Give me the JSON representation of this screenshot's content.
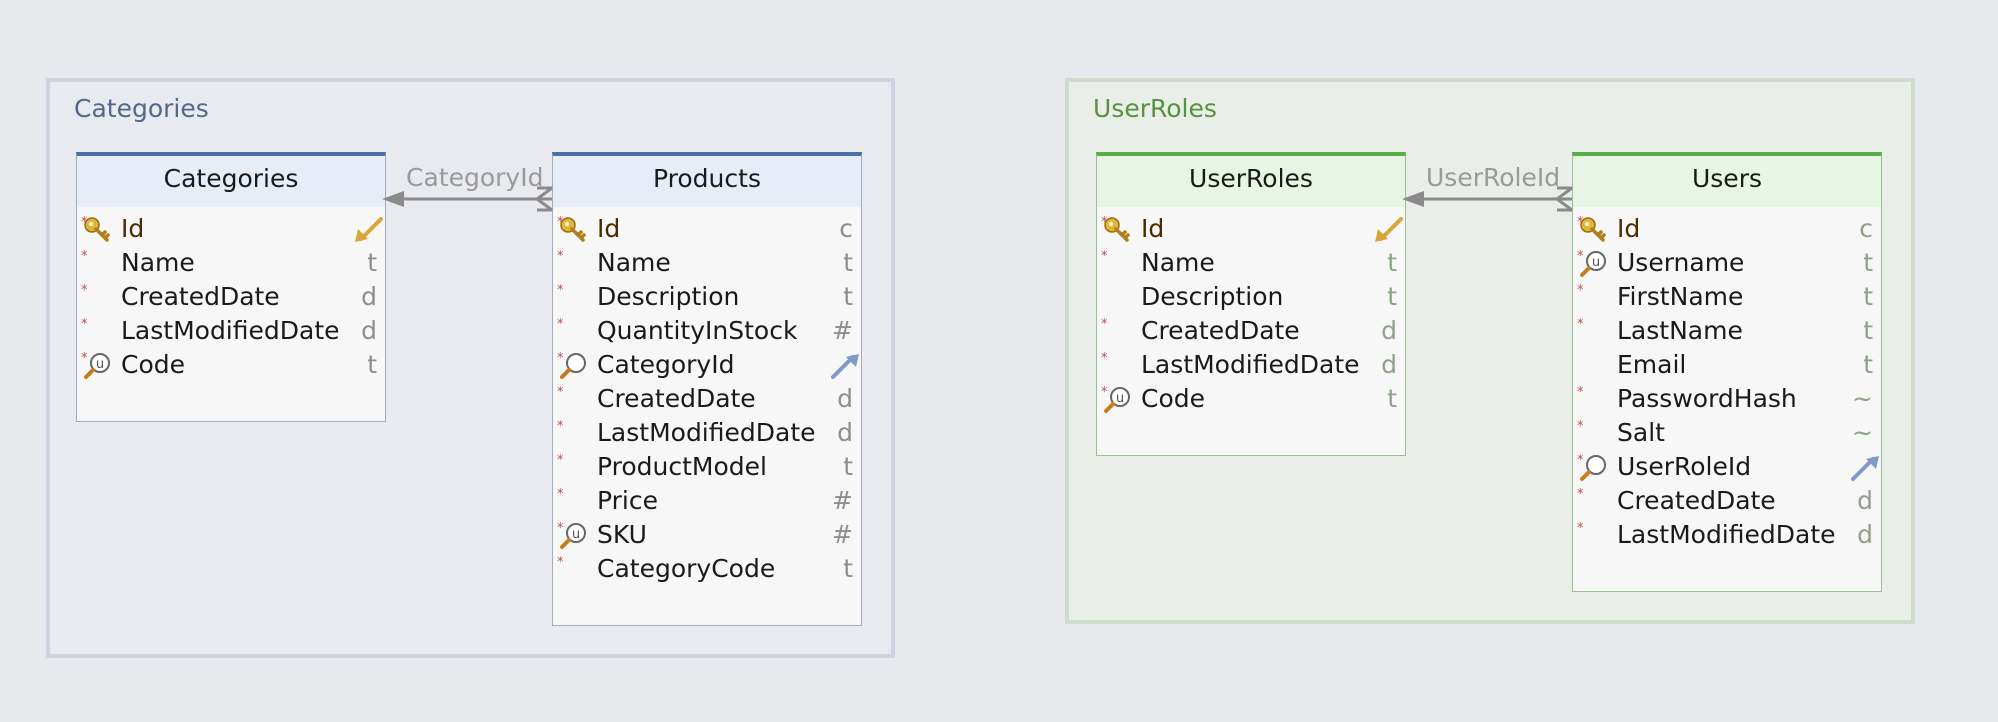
{
  "groups": [
    {
      "title": "Categories",
      "tables": [
        {
          "title": "Categories",
          "columns": [
            {
              "name": "Id",
              "type": "",
              "required": true,
              "icon": "key-icon",
              "type_icon": "key-ref-arrow-icon",
              "pk": true
            },
            {
              "name": "Name",
              "type": "t",
              "required": true,
              "icon": "",
              "pk": false
            },
            {
              "name": "CreatedDate",
              "type": "d",
              "required": true,
              "icon": "",
              "pk": false
            },
            {
              "name": "LastModifiedDate",
              "type": "d",
              "required": true,
              "icon": "",
              "pk": false
            },
            {
              "name": "Code",
              "type": "t",
              "required": true,
              "icon": "unique-index-icon",
              "pk": false
            }
          ]
        },
        {
          "title": "Products",
          "columns": [
            {
              "name": "Id",
              "type": "c",
              "required": true,
              "icon": "key-icon",
              "pk": true
            },
            {
              "name": "Name",
              "type": "t",
              "required": true,
              "icon": "",
              "pk": false
            },
            {
              "name": "Description",
              "type": "t",
              "required": true,
              "icon": "",
              "pk": false
            },
            {
              "name": "QuantityInStock",
              "type": "#",
              "required": true,
              "icon": "",
              "pk": false
            },
            {
              "name": "CategoryId",
              "type": "",
              "required": true,
              "icon": "index-icon",
              "type_icon": "foreign-key-arrow-icon",
              "pk": false
            },
            {
              "name": "CreatedDate",
              "type": "d",
              "required": true,
              "icon": "",
              "pk": false
            },
            {
              "name": "LastModifiedDate",
              "type": "d",
              "required": true,
              "icon": "",
              "pk": false
            },
            {
              "name": "ProductModel",
              "type": "t",
              "required": true,
              "icon": "",
              "pk": false
            },
            {
              "name": "Price",
              "type": "#",
              "required": true,
              "icon": "",
              "pk": false
            },
            {
              "name": "SKU",
              "type": "#",
              "required": true,
              "icon": "unique-index-icon",
              "pk": false
            },
            {
              "name": "CategoryCode",
              "type": "t",
              "required": true,
              "icon": "",
              "pk": false
            }
          ]
        }
      ],
      "relationship": {
        "label": "CategoryId"
      }
    },
    {
      "title": "UserRoles",
      "tables": [
        {
          "title": "UserRoles",
          "columns": [
            {
              "name": "Id",
              "type": "",
              "required": true,
              "icon": "key-icon",
              "type_icon": "key-ref-arrow-icon",
              "pk": true
            },
            {
              "name": "Name",
              "type": "t",
              "required": true,
              "icon": "",
              "pk": false
            },
            {
              "name": "Description",
              "type": "t",
              "required": false,
              "icon": "",
              "pk": false
            },
            {
              "name": "CreatedDate",
              "type": "d",
              "required": true,
              "icon": "",
              "pk": false
            },
            {
              "name": "LastModifiedDate",
              "type": "d",
              "required": true,
              "icon": "",
              "pk": false
            },
            {
              "name": "Code",
              "type": "t",
              "required": true,
              "icon": "unique-index-icon",
              "pk": false
            }
          ]
        },
        {
          "title": "Users",
          "columns": [
            {
              "name": "Id",
              "type": "c",
              "required": true,
              "icon": "key-icon",
              "pk": true
            },
            {
              "name": "Username",
              "type": "t",
              "required": true,
              "icon": "unique-index-icon",
              "pk": false
            },
            {
              "name": "FirstName",
              "type": "t",
              "required": true,
              "icon": "",
              "pk": false
            },
            {
              "name": "LastName",
              "type": "t",
              "required": true,
              "icon": "",
              "pk": false
            },
            {
              "name": "Email",
              "type": "t",
              "required": false,
              "icon": "",
              "pk": false
            },
            {
              "name": "PasswordHash",
              "type": "~",
              "required": true,
              "icon": "",
              "pk": false
            },
            {
              "name": "Salt",
              "type": "~",
              "required": true,
              "icon": "",
              "pk": false
            },
            {
              "name": "UserRoleId",
              "type": "",
              "required": true,
              "icon": "index-icon",
              "type_icon": "foreign-key-arrow-icon",
              "pk": false
            },
            {
              "name": "CreatedDate",
              "type": "d",
              "required": true,
              "icon": "",
              "pk": false
            },
            {
              "name": "LastModifiedDate",
              "type": "d",
              "required": true,
              "icon": "",
              "pk": false
            }
          ]
        }
      ],
      "relationship": {
        "label": "UserRoleId"
      }
    }
  ],
  "colors": {
    "blue_accent": "#4b6fa7",
    "green_accent": "#55b046",
    "blue_group_title": "#50698a",
    "green_group_title": "#58923f",
    "connector": "#8a8a8a"
  },
  "markers": {
    "required": "*"
  }
}
